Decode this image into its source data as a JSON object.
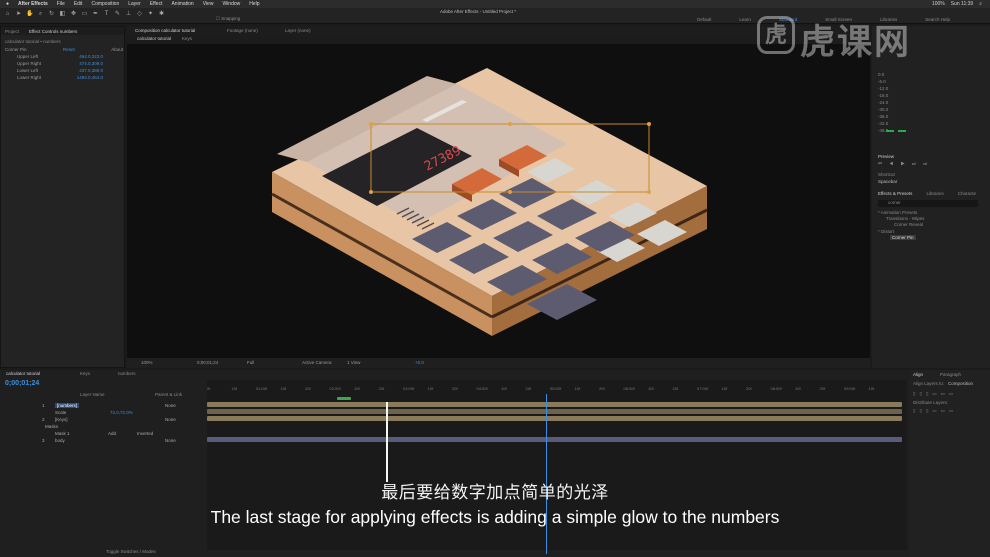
{
  "menubar": {
    "apple": "",
    "app": "After Effects",
    "items": [
      "File",
      "Edit",
      "Composition",
      "Layer",
      "Effect",
      "Animation",
      "View",
      "Window",
      "Help"
    ],
    "status": [
      "100%",
      "Sun 11:39"
    ]
  },
  "toolbar": {
    "window_title": "Adobe After Effects - Untitled Project *",
    "snapping": "Snapping",
    "workspaces": [
      "Default",
      "Learn",
      "Standard",
      "Small Screen",
      "Libraries"
    ],
    "search": "Search Help"
  },
  "project_panel": {
    "tabs": [
      "Project",
      "Effect Controls numbers"
    ],
    "subtitle": "calculator tutorial • numbers",
    "effect": {
      "name": "Corner Pin",
      "reset": "Reset",
      "about": "About"
    },
    "rows": [
      {
        "label": "Upper Left",
        "value": "464.0,323.0"
      },
      {
        "label": "Upper Right",
        "value": "474.0,309.0"
      },
      {
        "label": "Lower Left",
        "value": "437.0,389.0"
      },
      {
        "label": "Lower Right",
        "value": "1494.0,464.0"
      }
    ]
  },
  "composition": {
    "tabs": [
      "Composition calculator tutorial",
      "Footage (none)",
      "Layer (none)"
    ],
    "crumbs": [
      "calculator tutorial",
      "Keys"
    ],
    "display_number": "27389",
    "footer": {
      "zoom": "100%",
      "timecode": "0;00;01;24",
      "resolution": "Full",
      "camera": "Active Camera",
      "views": "1 View",
      "exposure": "+0.0"
    }
  },
  "right_panel": {
    "meter_values": [
      "0.0",
      "-6.0",
      "-12.0",
      "-18.0",
      "-24.0",
      "-30.0",
      "-36.0",
      "-42.0",
      "-48.0"
    ],
    "preview": "Preview",
    "shortcut": "Shortcut",
    "spacebar": "Spacebar",
    "effects_tabs": [
      "Effects & Presets",
      "Libraries",
      "Characte"
    ],
    "search_value": "corner",
    "tree": [
      "* Animation Presets",
      "Transitions - Wipes",
      "Corner Reveal",
      "* Distort",
      "Corner Pin"
    ]
  },
  "timeline": {
    "tabs": [
      "calculator tutorial",
      "Keys",
      "numbers"
    ],
    "timecode": "0;00;01;24",
    "col_headers": [
      "Layer Name",
      "Parent & Link"
    ],
    "layers": [
      {
        "num": "1",
        "name": "[numbers]",
        "mode": "None"
      },
      {
        "num": "",
        "name": "Scale",
        "value": "72.0,72.0%",
        "mode": ""
      },
      {
        "num": "2",
        "name": "[Keys]",
        "mode": "None"
      },
      {
        "num": "",
        "name": "Masks",
        "mode": ""
      },
      {
        "num": "",
        "name": "Mask 1",
        "add": "Add",
        "inverted": "Inverted",
        "mode": ""
      },
      {
        "num": "3",
        "name": "body",
        "mode": "None"
      }
    ],
    "ruler": [
      "0f",
      "10f",
      "01:00f",
      "10f",
      "20f",
      "02:00f",
      "10f",
      "20f",
      "03:00f",
      "10f",
      "20f",
      "04:00f",
      "10f",
      "20f",
      "05:00f",
      "10f",
      "20f",
      "06:00f",
      "10f",
      "20f",
      "07:00f",
      "10f",
      "20f",
      "08:00f",
      "10f",
      "20f",
      "09:00f",
      "10f"
    ],
    "footer": "Toggle Switches / Modes"
  },
  "align_panel": {
    "tabs": [
      "Align",
      "Paragraph"
    ],
    "align_to_label": "Align Layers to:",
    "align_to_value": "Composition",
    "distribute": "Distribute Layers:"
  },
  "subtitle": {
    "cn": "最后要给数字加点简单的光泽",
    "en": "The last stage for applying effects is adding a simple glow to the numbers"
  },
  "watermark": {
    "logo": "虎",
    "text": "虎课网"
  }
}
